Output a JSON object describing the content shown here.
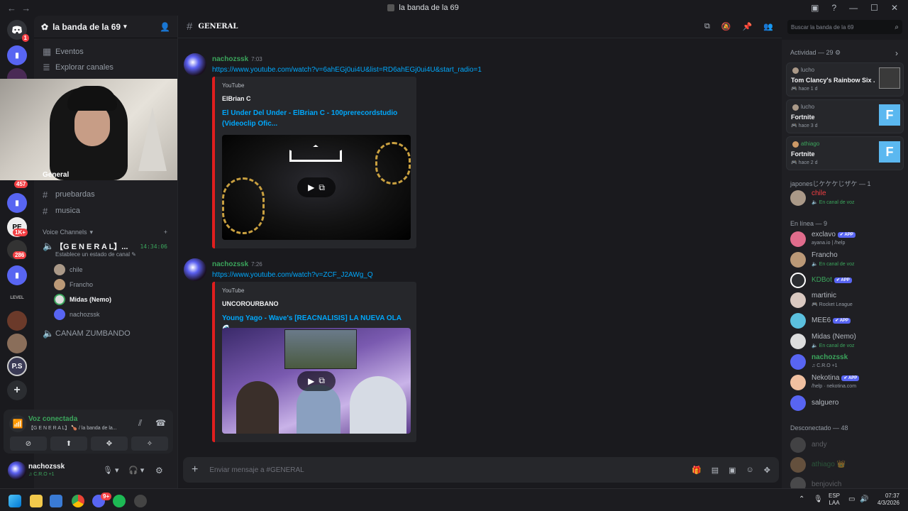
{
  "window": {
    "title": "la banda de la 69",
    "back": "←",
    "forward": "→"
  },
  "servers": {
    "dm_badge": "1",
    "badge_457": "457",
    "badge_1k": "1K+",
    "badge_286": "286",
    "level_label": "LEVEL",
    "ps_label": "P.S"
  },
  "guild": {
    "name": "la banda de la 69"
  },
  "sidebar": {
    "events": "Eventos",
    "browse": "Explorar canales",
    "partial_channel": "General",
    "text_channels": [
      "pruebardas",
      "musica"
    ],
    "voice_header": "Voice Channels",
    "voice_channel": "【G E N E R A L】...",
    "voice_timer": "14:34:06",
    "voice_status": "Establece un estado de canal",
    "voice_users": [
      "chile",
      "Francho",
      "Midas (Nemo)",
      "nachozssk"
    ],
    "voice_channel2": "CANAM ZUMBANDO"
  },
  "voice_panel": {
    "status": "Voz conectada",
    "channel": "【G E N E R A L】 🍗 / la banda de la..."
  },
  "user": {
    "name": "nachozssk",
    "status": "♫ C.R.O +1"
  },
  "channel": {
    "name": "GENERAL",
    "composer_placeholder": "Enviar mensaje a #GENERAL",
    "search_placeholder": "Buscar la banda de la 69"
  },
  "messages": [
    {
      "author": "nachozssk",
      "time": "7:03",
      "link": "https://www.youtube.com/watch?v=6ahEGj0ui4U&list=RD6ahEGj0ui4U&start_radio=1",
      "embed": {
        "provider": "YouTube",
        "author": "ElBrian C",
        "title": "El Under Del Under - ElBrian C - 100prerecordstudio (Videoclip Ofic..."
      }
    },
    {
      "author": "nachozssk",
      "time": "7:26",
      "link": "https://www.youtube.com/watch?v=ZCF_J2AWg_Q",
      "embed": {
        "provider": "YouTube",
        "author": "UNCOROURBANO",
        "title": "Young Yago - Wave's [REACNALISIS] LA NUEVA OLA 🌊"
      }
    }
  ],
  "members": {
    "activity_header": "Actividad — 29",
    "activities": [
      {
        "user": "lucho",
        "game": "Tom Clancy's Rainbow Six ...",
        "when": "hace 1 d"
      },
      {
        "user": "lucho",
        "game": "Fortnite",
        "when": "hace 3 d"
      },
      {
        "user": "athiago",
        "game": "Fortnite",
        "when": "hace 2 d"
      }
    ],
    "role_header": "japonesじケケケじザケ — 1",
    "role_members": [
      {
        "name": "chile",
        "sub": "En canal de voz",
        "color": "#f23f43"
      }
    ],
    "online_header": "En línea — 9",
    "online": [
      {
        "name": "exclavo",
        "app": "APP",
        "sub": "ayana.io | /help",
        "color": "#b5bac1"
      },
      {
        "name": "Francho",
        "app": "",
        "sub": "En canal de voz",
        "color": "#b5bac1"
      },
      {
        "name": "KDBot",
        "app": "APP",
        "sub": "",
        "color": "#3ba55c"
      },
      {
        "name": "martinic",
        "app": "",
        "sub": "Rocket League",
        "color": "#b5bac1"
      },
      {
        "name": "MEE6",
        "app": "APP",
        "sub": "",
        "color": "#b5bac1"
      },
      {
        "name": "Midas (Nemo)",
        "app": "",
        "sub": "En canal de voz",
        "color": "#b5bac1"
      },
      {
        "name": "nachozssk",
        "app": "",
        "sub": "♫ C.R.O +1",
        "color": "#3ba55c"
      },
      {
        "name": "Nekotina",
        "app": "APP",
        "sub": "/help · nekotina.com",
        "color": "#b5bac1"
      },
      {
        "name": "salguero",
        "app": "",
        "sub": "",
        "color": "#b5bac1"
      }
    ],
    "offline_header": "Desconectado — 48",
    "offline": [
      "andy",
      "athiago 👑",
      "benjovich"
    ]
  },
  "taskbar": {
    "lang": "ESP",
    "lang2": "LAA",
    "time": "07:37",
    "date": "4/3/2026",
    "discord_badge": "9+"
  },
  "colors": {
    "accent": "#5865f2",
    "link": "#00a8fc",
    "online": "#3ba55c",
    "embed_bar": "#e01e1e"
  }
}
